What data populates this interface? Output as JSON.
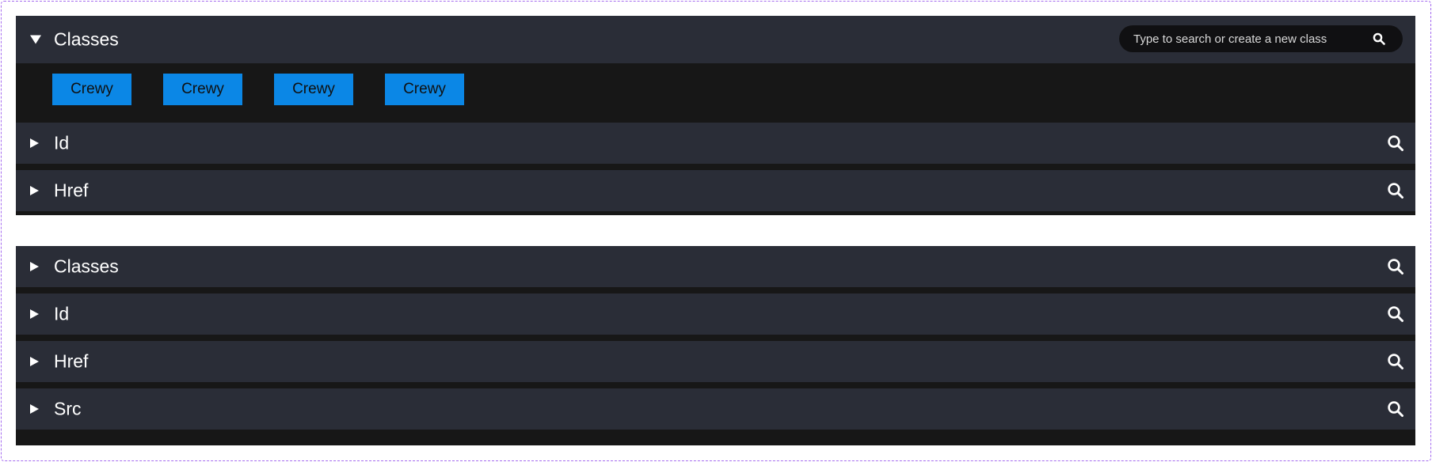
{
  "panel_top": {
    "classes": {
      "title": "Classes",
      "expanded": true,
      "search_placeholder": "Type to search or create a new class",
      "tags": [
        {
          "label": "Crewy"
        },
        {
          "label": "Crewy"
        },
        {
          "label": "Crewy"
        },
        {
          "label": "Crewy"
        }
      ]
    },
    "rows": [
      {
        "title": "Id"
      },
      {
        "title": "Href"
      }
    ]
  },
  "panel_bottom": {
    "rows": [
      {
        "title": "Classes"
      },
      {
        "title": "Id"
      },
      {
        "title": "Href"
      },
      {
        "title": "Src"
      }
    ]
  },
  "colors": {
    "row_bg": "#2a2d37",
    "panel_bg": "#171717",
    "tag_bg": "#0b87e6",
    "frame_border": "#a66cf0"
  },
  "icons": {
    "search": "magnifier-icon",
    "collapse": "triangle-right-icon",
    "expand": "triangle-down-icon"
  }
}
